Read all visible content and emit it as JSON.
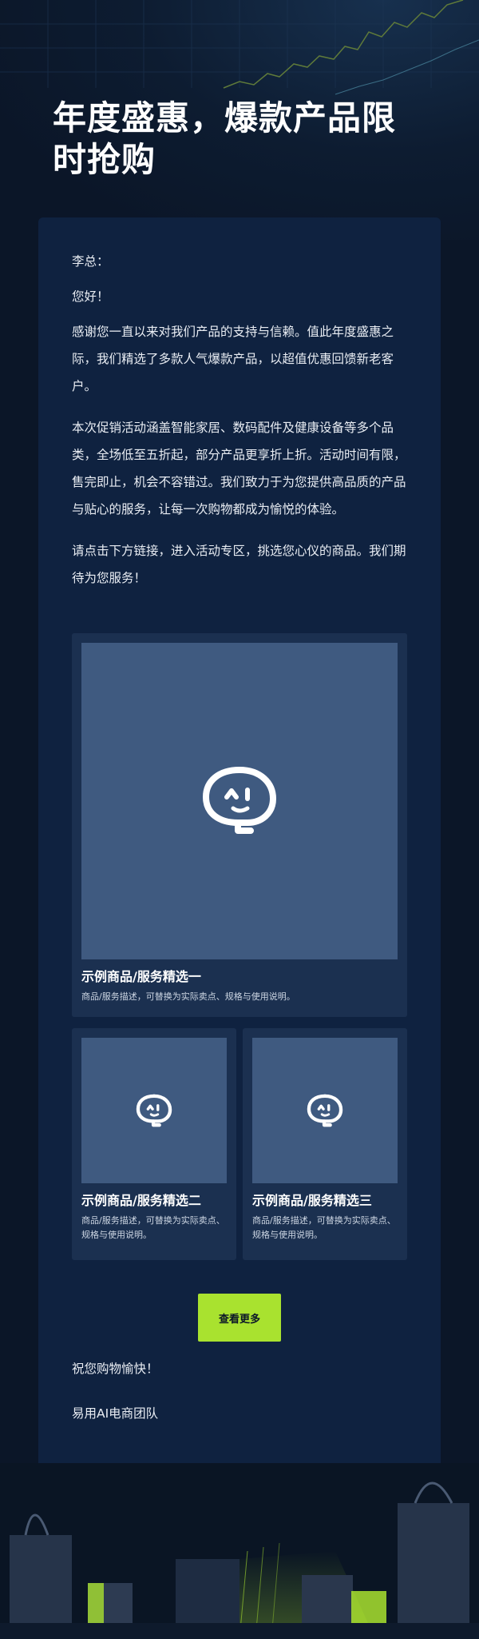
{
  "hero": {
    "title": "年度盛惠，爆款产品限时抢购"
  },
  "letter": {
    "salutation": "李总：",
    "greeting": "您好！",
    "paragraph1": "感谢您一直以来对我们产品的支持与信赖。值此年度盛惠之际，我们精选了多款人气爆款产品，以超值优惠回馈新老客户。",
    "paragraph2": "本次促销活动涵盖智能家居、数码配件及健康设备等多个品类，全场低至五折起，部分产品更享折上折。活动时间有限，售完即止，机会不容错过。我们致力于为您提供高品质的产品与贴心的服务，让每一次购物都成为愉悦的体验。",
    "paragraph3": "请点击下方链接，进入活动专区，挑选您心仪的商品。我们期待为您服务！",
    "closing": "祝您购物愉快！",
    "signature": "易用AI电商团队"
  },
  "products": [
    {
      "name": "示例商品/服务精选一",
      "desc": "商品/服务描述，可替换为实际卖点、规格与使用说明。",
      "icon": "robot-face-icon"
    },
    {
      "name": "示例商品/服务精选二",
      "desc": "商品/服务描述，可替换为实际卖点、规格与使用说明。",
      "icon": "robot-face-icon"
    },
    {
      "name": "示例商品/服务精选三",
      "desc": "商品/服务描述，可替换为实际卖点、规格与使用说明。",
      "icon": "robot-face-icon"
    }
  ],
  "cta": {
    "label": "查看更多"
  },
  "colors": {
    "background": "#0b1628",
    "card": "#0f2240",
    "product_card": "#1b3050",
    "placeholder": "#3f5a80",
    "accent": "#a9e22f"
  }
}
